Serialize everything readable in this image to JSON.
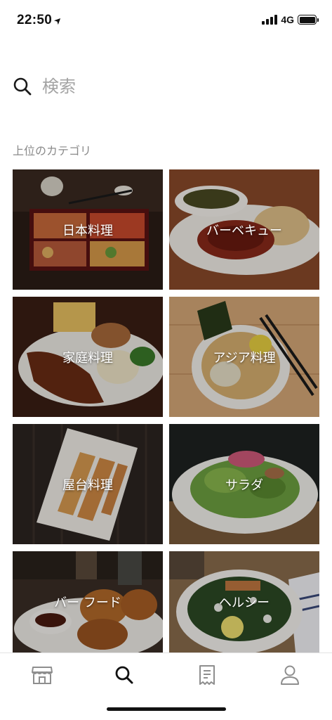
{
  "status_bar": {
    "time": "22:50",
    "network": "4G"
  },
  "search": {
    "placeholder": "検索"
  },
  "section": {
    "title": "上位のカテゴリ"
  },
  "categories": [
    {
      "label": "日本料理"
    },
    {
      "label": "バーベキュー"
    },
    {
      "label": "家庭料理"
    },
    {
      "label": "アジア料理"
    },
    {
      "label": "屋台料理"
    },
    {
      "label": "サラダ"
    },
    {
      "label": "バー フード"
    },
    {
      "label": "ヘルシー"
    }
  ],
  "tab_bar": {
    "items": [
      {
        "icon": "store-icon"
      },
      {
        "icon": "search-icon",
        "active": true
      },
      {
        "icon": "receipt-icon"
      },
      {
        "icon": "profile-icon"
      }
    ]
  },
  "colors": {
    "active_tab": "#111111",
    "inactive_tab": "#8e8e8e",
    "placeholder": "#a3a3a3",
    "section_title": "#8a8a8a"
  }
}
